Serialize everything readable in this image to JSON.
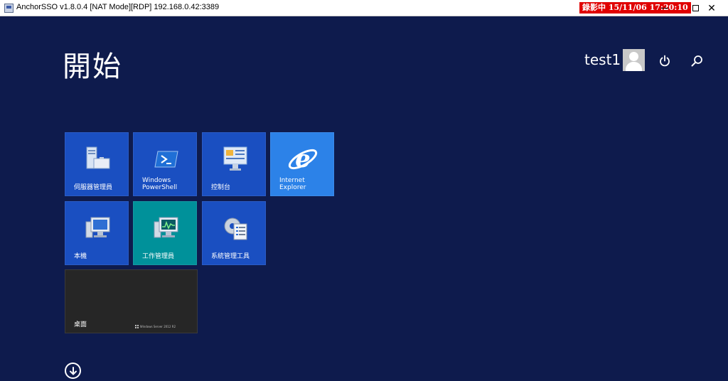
{
  "window": {
    "title": "AnchorSSO v1.8.0.4 [NAT Mode][RDP] 192.168.0.42:3389",
    "recording_badge": "錄影中 15/11/06 17:20:10",
    "recording_color": "#e00000"
  },
  "start": {
    "title": "開始",
    "user_name": "test1",
    "icons": {
      "avatar": "user-avatar-icon",
      "power": "power-icon",
      "search": "search-icon",
      "apps": "arrow-down-circle-icon"
    }
  },
  "tiles": [
    {
      "label": "伺服器管理員",
      "icon": "server-manager-icon",
      "color": "#1a4fc1"
    },
    {
      "label": "Windows\nPowerShell",
      "icon": "powershell-icon",
      "color": "#1a4fc1"
    },
    {
      "label": "控制台",
      "icon": "control-panel-icon",
      "color": "#1a4fc1"
    },
    {
      "label": "Internet\nExplorer",
      "icon": "internet-explorer-icon",
      "color": "#2c82e8"
    },
    {
      "label": "本機",
      "icon": "this-pc-icon",
      "color": "#1a4fc1"
    },
    {
      "label": "工作管理員",
      "icon": "task-manager-icon",
      "color": "#00919a"
    },
    {
      "label": "系統管理工具",
      "icon": "admin-tools-icon",
      "color": "#1a4fc1"
    },
    {
      "label": "桌面",
      "icon": "desktop-icon",
      "color": "#262626",
      "brand": "Windows Server 2012 R2"
    }
  ]
}
